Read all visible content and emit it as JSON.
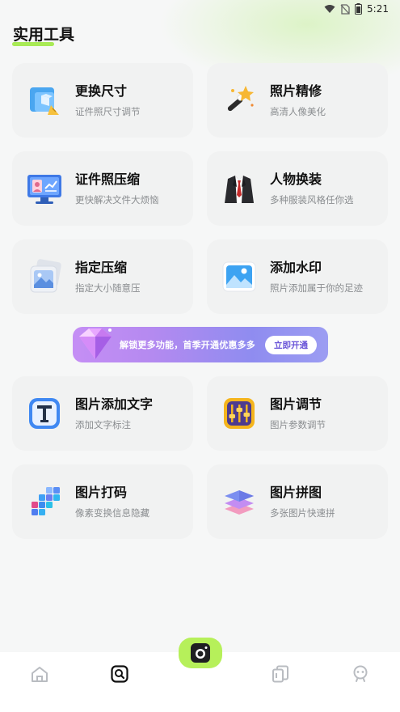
{
  "status_bar": {
    "time": "5:21"
  },
  "page": {
    "title": "实用工具"
  },
  "tools": [
    {
      "title": "更换尺寸",
      "subtitle": "证件照尺寸调节",
      "icon": "resize-icon"
    },
    {
      "title": "照片精修",
      "subtitle": "高清人像美化",
      "icon": "magic-wand-icon"
    },
    {
      "title": "证件照压缩",
      "subtitle": "更快解决文件大烦恼",
      "icon": "monitor-id-icon"
    },
    {
      "title": "人物换装",
      "subtitle": "多种服装风格任你选",
      "icon": "suit-icon"
    },
    {
      "title": "指定压缩",
      "subtitle": "指定大小随意压",
      "icon": "image-stack-icon"
    },
    {
      "title": "添加水印",
      "subtitle": "照片添加属于你的足迹",
      "icon": "picture-icon"
    },
    {
      "title": "图片添加文字",
      "subtitle": "添加文字标注",
      "icon": "text-t-icon"
    },
    {
      "title": "图片调节",
      "subtitle": "图片参数调节",
      "icon": "sliders-icon"
    },
    {
      "title": "图片打码",
      "subtitle": "像素变换信息隐藏",
      "icon": "mosaic-icon"
    },
    {
      "title": "图片拼图",
      "subtitle": "多张图片快速拼",
      "icon": "layers-icon"
    }
  ],
  "banner": {
    "text": "解锁更多功能，首季开通优惠多多",
    "button": "立即开通"
  },
  "tabbar": {
    "items": [
      "home-icon",
      "tools-icon",
      "camera-icon",
      "documents-icon",
      "profile-icon"
    ],
    "active": "tools-icon",
    "accent": "#b6f05a"
  },
  "colors": {
    "accent": "#a8ea55",
    "card_bg": "#f1f2f2",
    "subtitle": "#8a8d90"
  }
}
